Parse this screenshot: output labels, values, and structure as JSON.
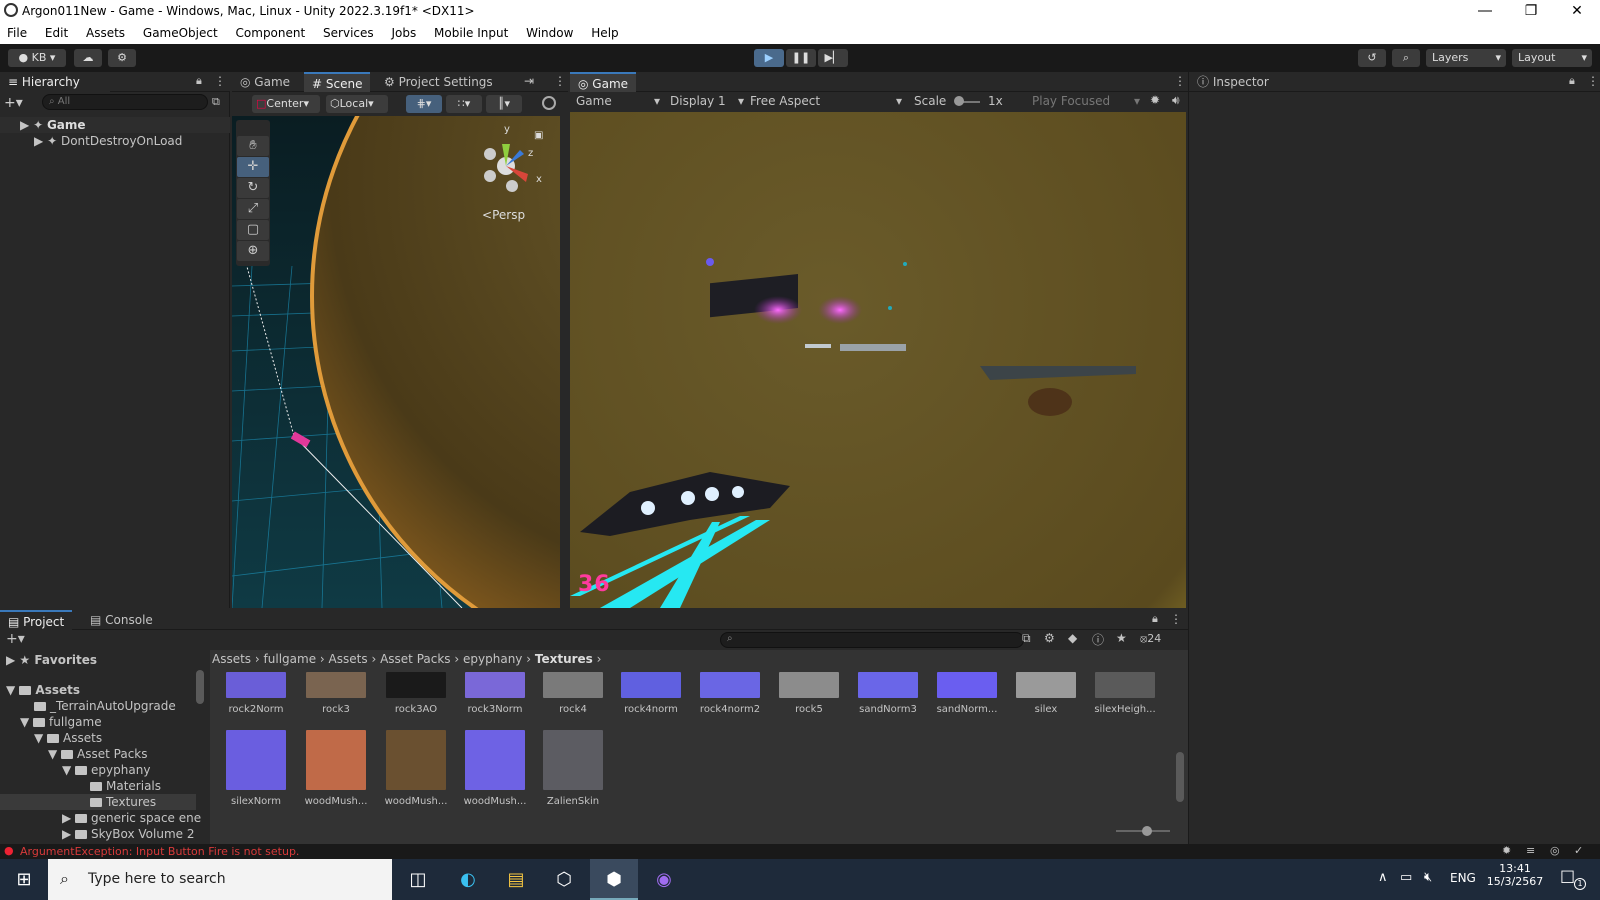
{
  "window": {
    "title": "Argon011New - Game - Windows, Mac, Linux - Unity 2022.3.19f1* <DX11>",
    "minimize_icon": "minimize-icon",
    "restore_icon": "restore-icon",
    "close_icon": "close-icon"
  },
  "menu": [
    "File",
    "Edit",
    "Assets",
    "GameObject",
    "Component",
    "Services",
    "Jobs",
    "Mobile Input",
    "Window",
    "Help"
  ],
  "toolbar": {
    "account": "KB",
    "layers": "Layers",
    "layout": "Layout"
  },
  "hierarchy": {
    "tab": "Hierarchy",
    "search_placeholder": "All",
    "items": [
      "Game",
      "DontDestroyOnLoad"
    ]
  },
  "center_tabs": [
    "Game",
    "Scene",
    "Project Settings"
  ],
  "scene": {
    "pivot": "Center",
    "space": "Local",
    "persp": "Persp",
    "axis_y": "y",
    "axis_z": "z",
    "axis_x": "x"
  },
  "game": {
    "tab": "Game",
    "mode": "Game",
    "display": "Display 1",
    "aspect": "Free Aspect",
    "scale_label": "Scale",
    "scale_value": "1x",
    "play_focused": "Play Focused",
    "hud_number": "36"
  },
  "inspector": {
    "tab": "Inspector"
  },
  "project": {
    "tabs": [
      "Project",
      "Console"
    ],
    "favorites": "Favorites",
    "hidden_count": "24",
    "tree": [
      "Assets",
      "_TerrainAutoUpgrade",
      "fullgame",
      "Assets",
      "Asset Packs",
      "epyphany",
      "Materials",
      "Textures",
      "generic space ene",
      "SkyBox Volume 2"
    ],
    "breadcrumb": [
      "Assets",
      "fullgame",
      "Assets",
      "Asset Packs",
      "epyphany",
      "Textures"
    ],
    "assets_row1": [
      "rock2Norm",
      "rock3",
      "rock3AO",
      "rock3Norm",
      "rock4",
      "rock4norm",
      "rock4norm2",
      "rock5",
      "sandNorm3",
      "sandNorm...",
      "silex",
      "silexHeigh..."
    ],
    "assets_row2": [
      "silexNorm",
      "woodMush...",
      "woodMush...",
      "woodMush...",
      "ZalienSkin"
    ]
  },
  "status": {
    "error": "ArgumentException: Input Button Fire is not setup."
  },
  "taskbar": {
    "search_placeholder": "Type here to search",
    "language": "ENG",
    "time": "13:41",
    "date": "15/3/2567",
    "notification_count": "1"
  }
}
